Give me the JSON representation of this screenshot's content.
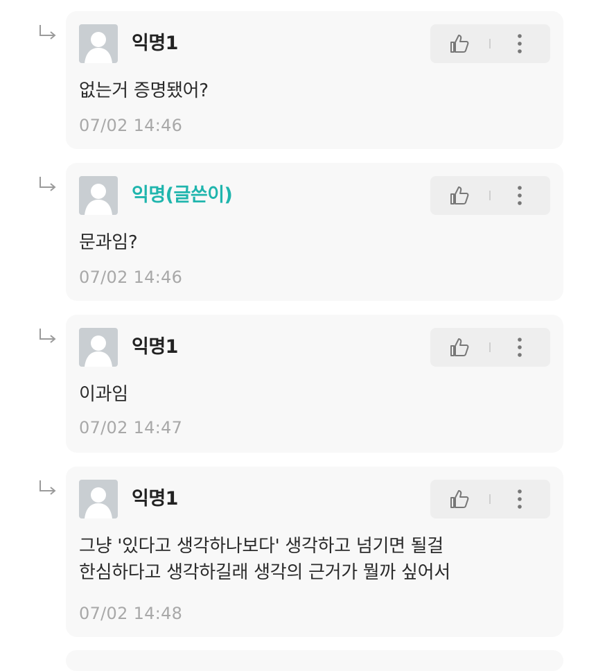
{
  "colors": {
    "card_bg": "#f8f8f8",
    "author_accent": "#1fb5ad",
    "timestamp": "#a8a8a8",
    "action_bg": "#eeeeee"
  },
  "icons": {
    "reply": "reply-arrow-icon",
    "like": "thumbs-up-icon",
    "more": "more-vertical-icon",
    "avatar": "default-avatar-icon"
  },
  "comments": [
    {
      "nickname": "익명1",
      "is_author": false,
      "content": "없는거 증명됐어?",
      "timestamp": "07/02 14:46"
    },
    {
      "nickname": "익명(글쓴이)",
      "is_author": true,
      "content": "문과임?",
      "timestamp": "07/02 14:46"
    },
    {
      "nickname": "익명1",
      "is_author": false,
      "content": "이과임",
      "timestamp": "07/02 14:47"
    },
    {
      "nickname": "익명1",
      "is_author": false,
      "content": "그냥 '있다고 생각하나보다' 생각하고 넘기면 될걸\n한심하다고 생각하길래 생각의 근거가 뭘까 싶어서",
      "timestamp": "07/02 14:48"
    }
  ]
}
